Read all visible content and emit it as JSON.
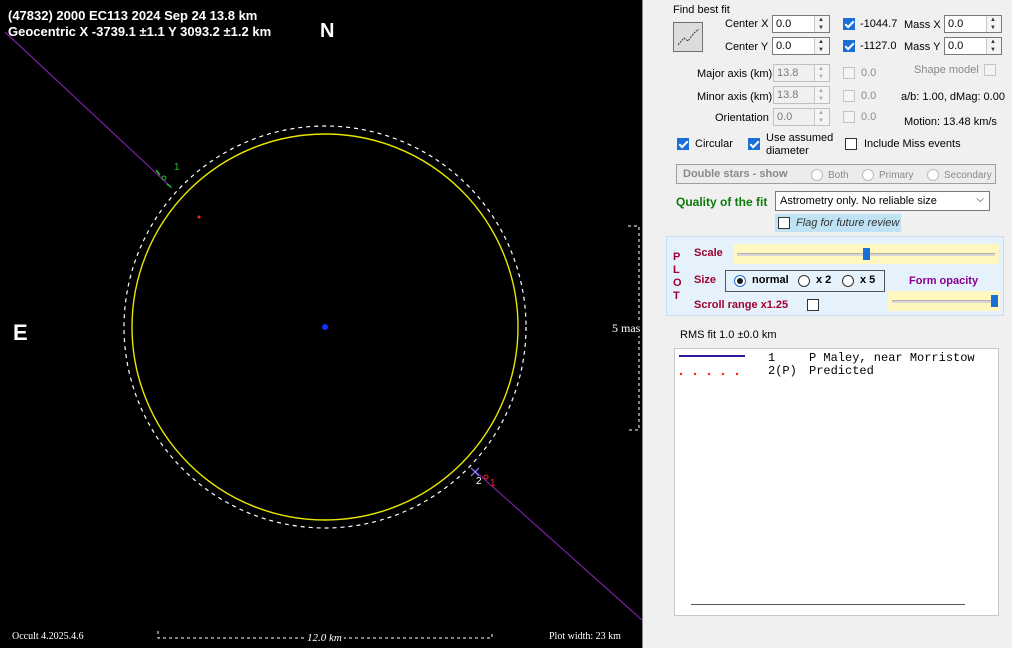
{
  "plot": {
    "title_line1": "(47832) 2000 EC113  2024 Sep 24   13.8 km",
    "title_line2": "Geocentric  X  -3739.1 ±1.1  Y 3093.2 ±1.2 km",
    "north": "N",
    "east": "E",
    "scale_mas": "5 mas",
    "scale_km": "12.0 km",
    "version": "Occult 4.2025.4.6",
    "plot_width": "Plot width: 23 km",
    "chord_labels": {
      "top_1": "1",
      "bottom_2": "2",
      "bottom_1": "1"
    },
    "colors": {
      "ellipse": "#e8e800",
      "limb": "#ffffff",
      "chord": "#7a1fa2",
      "center": "#1030ff",
      "predicted": "#ff2020",
      "marker_green": "#20c020"
    }
  },
  "fit": {
    "header": "Find best fit",
    "center_x_label": "Center X",
    "center_x_value": "0.0",
    "center_y_label": "Center Y",
    "center_y_value": "0.0",
    "mass_x_num": "-1044.7",
    "mass_x_label": "Mass X",
    "mass_x_value": "0.0",
    "mass_y_num": "-1127.0",
    "mass_y_label": "Mass Y",
    "mass_y_value": "0.0",
    "major_label": "Major axis (km)",
    "major_value": "13.8",
    "major_check": "0.0",
    "minor_label": "Minor axis (km)",
    "minor_value": "13.8",
    "minor_check": "0.0",
    "orient_label": "Orientation",
    "orient_value": "0.0",
    "orient_check": "0.0",
    "shape_model": "Shape model",
    "ab_dmag": "a/b: 1.00, dMag: 0.00",
    "motion": "Motion: 13.48 km/s",
    "circular": "Circular",
    "use_assumed": "Use assumed",
    "diameter": "diameter",
    "include_miss": "Include Miss events",
    "double_stars": "Double stars - show",
    "both": "Both",
    "primary": "Primary",
    "secondary": "Secondary",
    "quality_label": "Quality of the fit",
    "quality_value": "Astrometry only. No reliable size",
    "flag_review": "Flag for future review"
  },
  "plotpanel": {
    "side_letters": [
      "P",
      "L",
      "O",
      "T"
    ],
    "scale": "Scale",
    "size": "Size",
    "normal": "normal",
    "x2": "x 2",
    "x5": "x 5",
    "form_opacity": "Form opacity",
    "scroll_range": "Scroll range x1.25",
    "scale_level": 0.5,
    "opacity_level": 0.98
  },
  "rms": "RMS fit 1.0 ±0.0 km",
  "legend": {
    "rows": [
      {
        "num": "1",
        "text": "P Maley, near Morristow"
      },
      {
        "num": "2(P)",
        "text": "Predicted"
      }
    ]
  }
}
